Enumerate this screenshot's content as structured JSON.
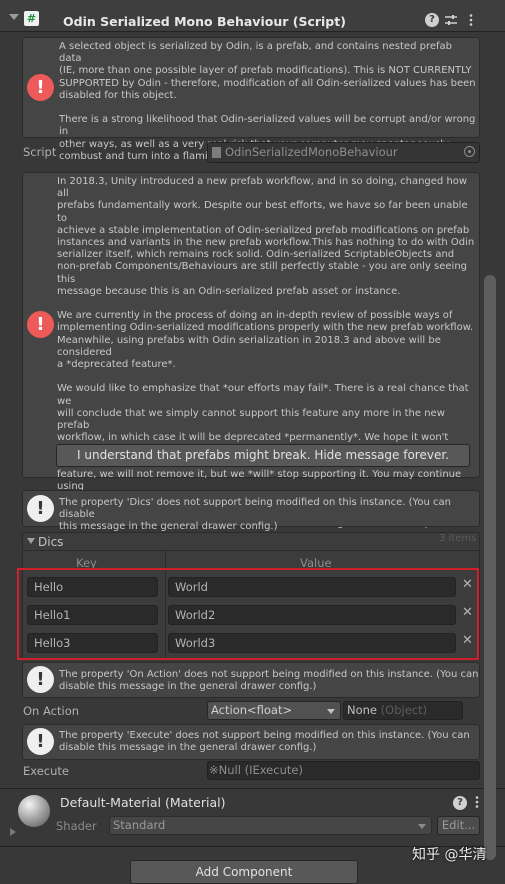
{
  "header": {
    "title": "Odin Serialized Mono Behaviour (Script)",
    "script_icon": "#"
  },
  "warning1": {
    "text": "A selected object is serialized by Odin, is a prefab, and contains nested prefab data\n(IE, more than one possible layer of prefab modifications). This is NOT CURRENTLY\nSUPPORTED by Odin - therefore, modification of all Odin-serialized values has been\ndisabled for this object.\n\nThere is a strong likelihood that Odin-serialized values will be corrupt and/or wrong in\nother ways, as well as a very real risk that your computer may spontaneously\ncombust and turn into a flaming wheel of cheese."
  },
  "script_field": {
    "label": "Script",
    "value": "OdinSerializedMonoBehaviour"
  },
  "warning2": {
    "text": "In 2018.3, Unity introduced a new prefab workflow, and in so doing, changed how all\nprefabs fundamentally work. Despite our best efforts, we have so far been unable to\nachieve a stable implementation of Odin-serialized prefab modifications on prefab\ninstances and variants in the new prefab workflow.This has nothing to do with Odin\nserializer itself, which remains rock solid. Odin-serialized ScriptableObjects and\nnon-prefab Components/Behaviours are still perfectly stable - you are only seeing this\nmessage because this is an Odin-serialized prefab asset or instance.\n\nWe are currently in the process of doing an in-depth review of possible ways of\nimplementing Odin-serialized modifications properly with the new prefab workflow.\nMeanwhile, using prefabs with Odin serialization in 2018.3 and above will be considered\na *deprecated feature*.\n\nWe would like to emphasize that *our efforts may fail*. There is a real chance that we\nwill conclude that we simply cannot support this feature any more in the new prefab\nworkflow, in which case it will be deprecated *permanently*. We hope it won't come to\nthat, but we sadly cannot promise that it won't happen. If we do deprecate the\nfeature, we will not remove it, but we *will* stop supporting it. You may continue using\nit, but only at your own risk.\n\nPlease keep all this in mind, if you wish to continue using Odin-serialized prefabs.",
    "button_label": "I understand that prefabs might break. Hide message forever."
  },
  "info_dics": {
    "text": "The property 'Dics' does not support being modified on this instance. (You can disable\nthis message in the general drawer config.)"
  },
  "dics": {
    "label": "Dics",
    "count": "3 items",
    "key_header": "Key",
    "value_header": "Value",
    "rows": [
      {
        "key": "Hello",
        "value": "World"
      },
      {
        "key": "Hello1",
        "value": "World2"
      },
      {
        "key": "Hello3",
        "value": "World3"
      }
    ],
    "highlight_color": "#d0202a"
  },
  "info_on_action": {
    "text": "The property 'On Action' does not support being modified on this instance. (You can\ndisable this message in the general drawer config.)"
  },
  "on_action": {
    "label": "On Action",
    "dropdown": "Action<float>",
    "target": "None",
    "target_type": "(Object)"
  },
  "info_execute": {
    "text": "The property 'Execute' does not support being modified on this instance. (You can\ndisable this message in the general drawer config.)"
  },
  "execute": {
    "label": "Execute",
    "value": "Null (IExecute)",
    "prefix_glyph": "※"
  },
  "material": {
    "title": "Default-Material (Material)",
    "shader_label": "Shader",
    "shader_value": "Standard",
    "edit_label": "Edit..."
  },
  "add_component_label": "Add Component",
  "watermark": "知乎 @华清"
}
